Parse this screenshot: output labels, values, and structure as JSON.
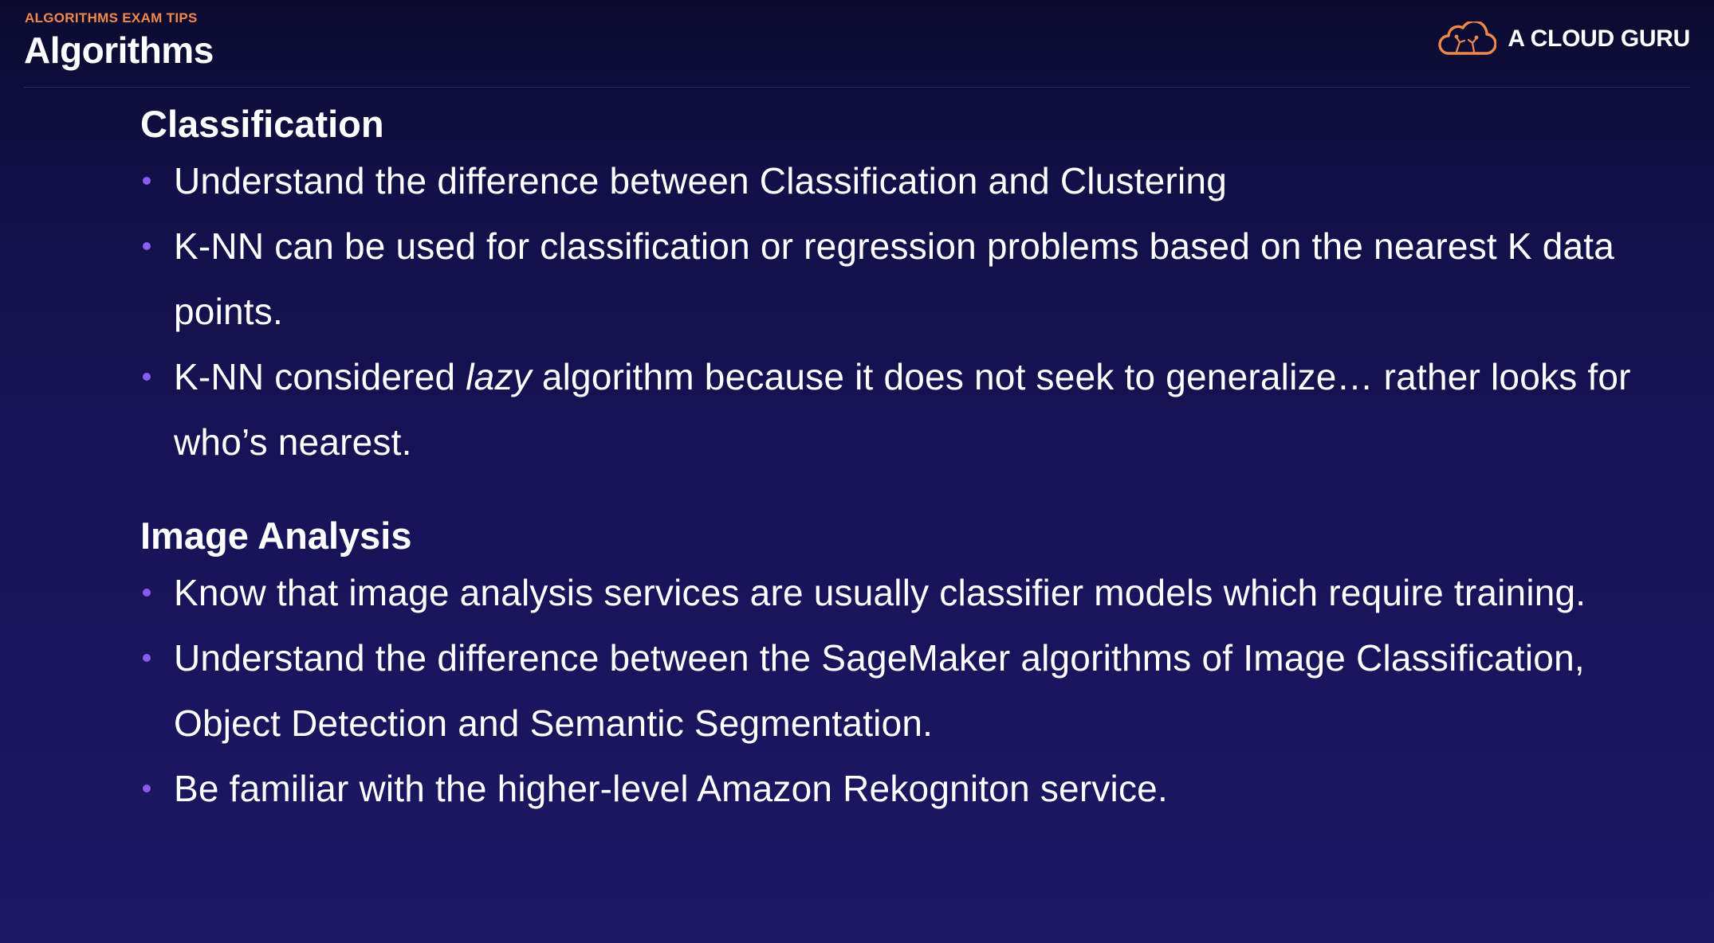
{
  "header": {
    "eyebrow": "ALGORITHMS EXAM TIPS",
    "title": "Algorithms",
    "brand_name": "A CLOUD GURU",
    "brand_icon": "cloud-logo-icon"
  },
  "colors": {
    "accent_orange": "#f1884a",
    "bullet_purple": "#8a5cf0",
    "background_top": "#0b0a2e",
    "background_bottom": "#1c1763"
  },
  "sections": [
    {
      "heading": "Classification",
      "bullets": [
        {
          "text": "Understand the difference between Classification and Clustering"
        },
        {
          "text": "K-NN can be used for classification or regression problems based on the nearest K data points."
        },
        {
          "before": "K-NN considered ",
          "italic": "lazy",
          "after": " algorithm because it does not seek to generalize… rather looks for who’s nearest."
        }
      ]
    },
    {
      "heading": "Image Analysis",
      "bullets": [
        {
          "text": "Know that image analysis services are usually classifier models which require training."
        },
        {
          "text": "Understand the difference between the SageMaker algorithms of Image Classification, Object Detection and Semantic Segmentation."
        },
        {
          "text": "Be familiar with the higher-level Amazon Rekogniton service."
        }
      ]
    }
  ]
}
